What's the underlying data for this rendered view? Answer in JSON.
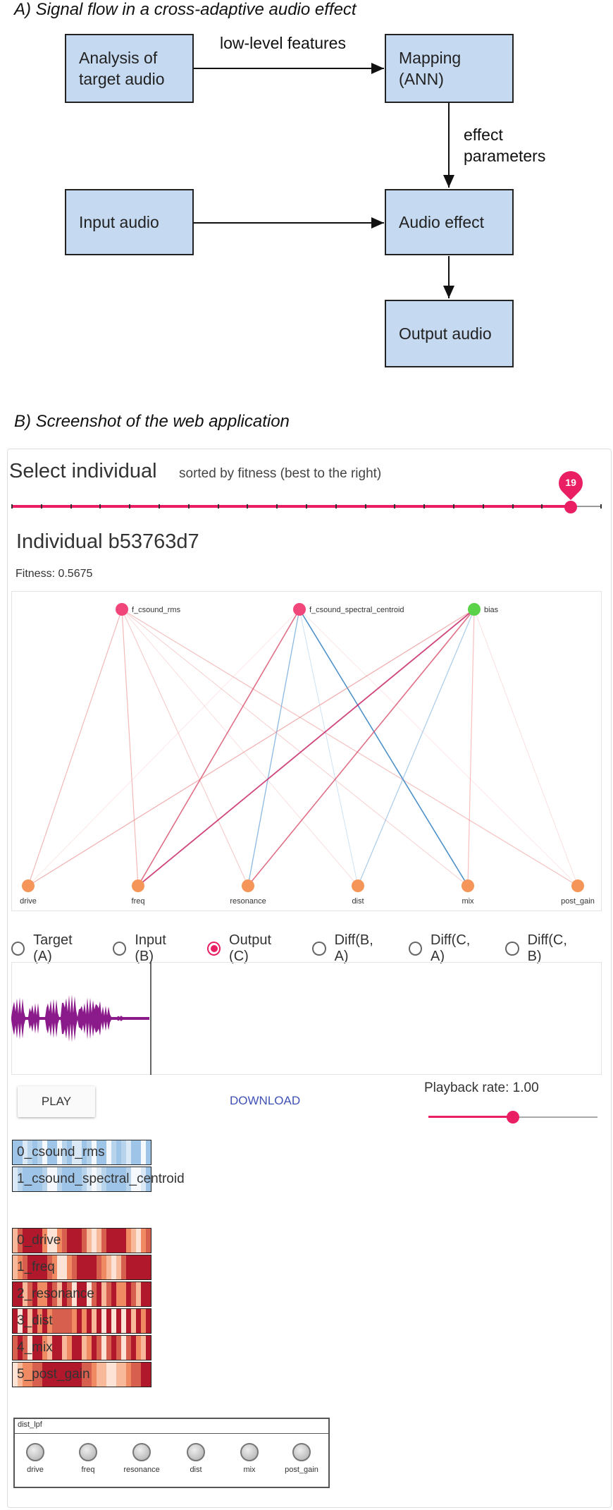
{
  "section_a": {
    "title": "A) Signal flow in a cross-adaptive audio effect",
    "boxes": {
      "analysis": "Analysis of target audio",
      "mapping": "Mapping (ANN)",
      "input": "Input audio",
      "effect": "Audio effect",
      "output": "Output audio"
    },
    "labels": {
      "low_level": "low-level features",
      "effect_params": "effect parameters"
    }
  },
  "section_b": {
    "title": "B) Screenshot of the web application"
  },
  "app": {
    "header_title": "Select individual",
    "header_subtitle": "sorted by fitness (best to the right)",
    "slider": {
      "value": 19,
      "fraction": 0.95
    },
    "individual_title": "Individual b53763d7",
    "fitness": "Fitness: 0.5675",
    "network": {
      "inputs": [
        "f_csound_rms",
        "f_csound_spectral_centroid",
        "bias"
      ],
      "outputs": [
        "drive",
        "freq",
        "resonance",
        "dist",
        "mix",
        "post_gain"
      ]
    },
    "radios": [
      {
        "label": "Target (A)",
        "selected": false
      },
      {
        "label": "Input (B)",
        "selected": false
      },
      {
        "label": "Output (C)",
        "selected": true
      },
      {
        "label": "Diff(B, A)",
        "selected": false
      },
      {
        "label": "Diff(C, A)",
        "selected": false
      },
      {
        "label": "Diff(C, B)",
        "selected": false
      }
    ],
    "play_label": "PLAY",
    "download_label": "DOWNLOAD",
    "playback_rate_label": "Playback rate: 1.00",
    "playback_rate_fraction": 0.5,
    "feature_tracks": [
      "0_csound_rms",
      "1_csound_spectral_centroid"
    ],
    "param_tracks": [
      "0_drive",
      "1_freq",
      "2_resonance",
      "3_dist",
      "4_mix",
      "5_post_gain"
    ],
    "knob_panel": {
      "title": "dist_lpf",
      "knobs": [
        "drive",
        "freq",
        "resonance",
        "dist",
        "mix",
        "post_gain"
      ]
    },
    "colors": {
      "accent": "#e91e63",
      "input_node": "#f0467a",
      "bias_node": "#5ad348",
      "output_node": "#f5955a",
      "link": "#3f51b5",
      "box_fill": "#c5d9f1"
    }
  }
}
